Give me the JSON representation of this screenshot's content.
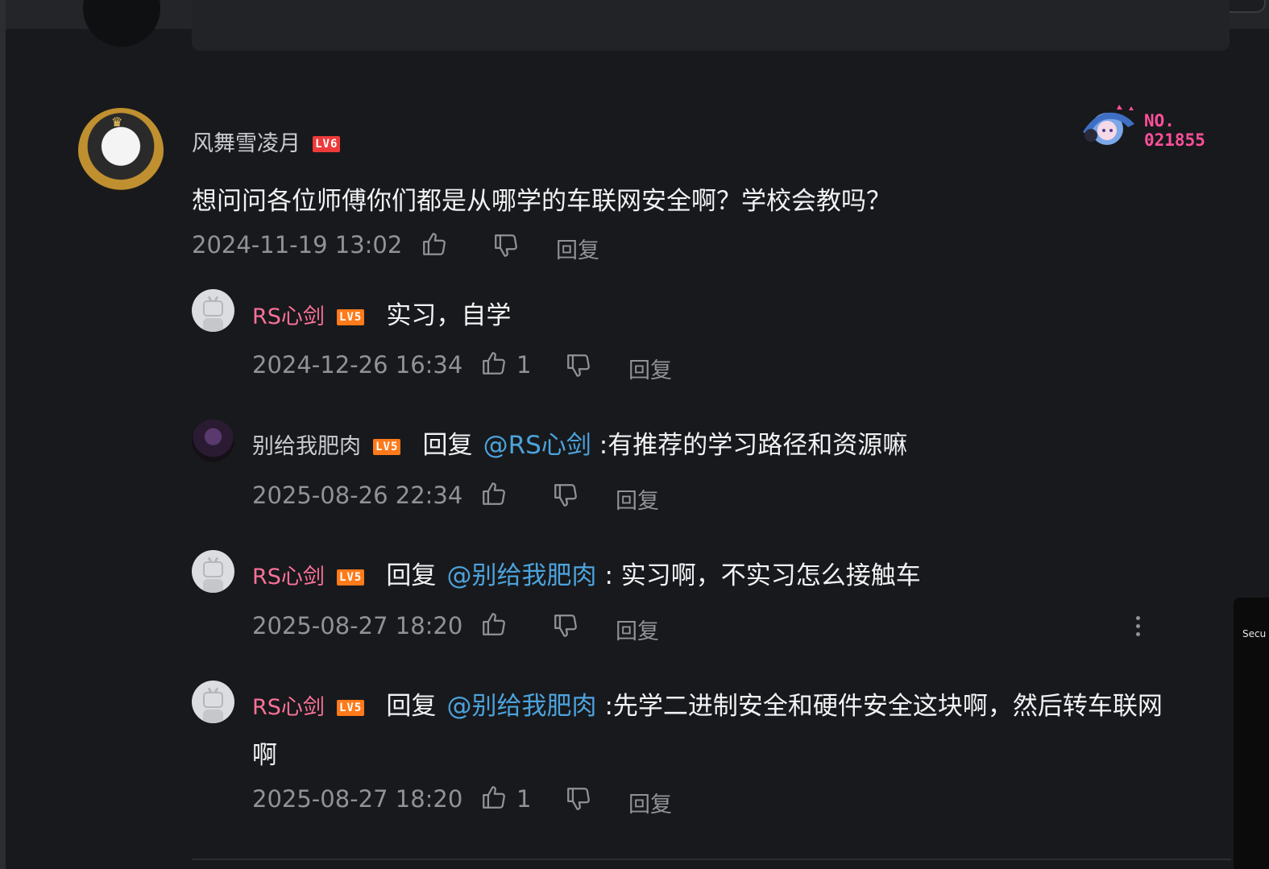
{
  "main_comment": {
    "username": "风舞雪凌月",
    "level": "LV6",
    "text": "想问问各位师傅你们都是从哪学的车联网安全啊？学校会教吗？",
    "time": "2024-11-19 13:02",
    "reply_label": "回复",
    "badge_no": "NO.",
    "badge_num": "021855"
  },
  "replies": [
    {
      "username": "RS心剑",
      "level": "LV5",
      "text": "实习，自学",
      "time": "2024-12-26 16:34",
      "likes": "1",
      "reply_label": "回复"
    },
    {
      "username": "别给我肥肉",
      "level": "LV5",
      "prefix": "回复",
      "mention": "@RS心剑",
      "text": ":有推荐的学习路径和资源嘛",
      "time": "2025-08-26 22:34",
      "reply_label": "回复"
    },
    {
      "username": "RS心剑",
      "level": "LV5",
      "prefix": "回复",
      "mention": "@别给我肥肉",
      "text": ": 实习啊，不实习怎么接触车",
      "time": "2025-08-27 18:20",
      "reply_label": "回复"
    },
    {
      "username": "RS心剑",
      "level": "LV5",
      "prefix": "回复",
      "mention": "@别给我肥肉",
      "text": ":先学二进制安全和硬件安全这块啊，然后转车联网",
      "text_line2": "啊",
      "time": "2025-08-27 18:20",
      "likes": "1",
      "reply_label": "回复"
    }
  ],
  "side_panel": {
    "text": "Secu"
  },
  "colors": {
    "background": "#18191c",
    "pink_name": "#fb7299",
    "mention": "#4ca3dd",
    "meta": "#8f9297"
  },
  "icons": [
    "like-icon",
    "dislike-icon",
    "more-icon"
  ]
}
